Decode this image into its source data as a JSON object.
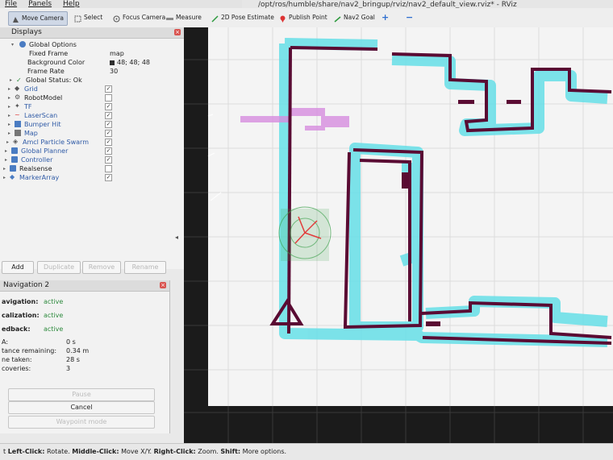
{
  "menu": {
    "items": [
      "File",
      "Panels",
      "Help"
    ]
  },
  "window": {
    "title": "/opt/ros/humble/share/nav2_bringup/rviz/nav2_default_view.rviz* - RViz"
  },
  "toolbar": {
    "move_camera": "Move Camera",
    "select": "Select",
    "focus_camera": "Focus Camera",
    "measure": "Measure",
    "pose_estimate": "2D Pose Estimate",
    "publish_point": "Publish Point",
    "nav2_goal": "Nav2 Goal",
    "plus": "+",
    "minus": "−"
  },
  "displays": {
    "title": "Displays",
    "global_options": "Global Options",
    "fixed_frame_label": "Fixed Frame",
    "fixed_frame_value": "map",
    "bg_color_label": "Background Color",
    "bg_color_value": "48; 48; 48",
    "frame_rate_label": "Frame Rate",
    "frame_rate_value": "30",
    "global_status": "Global Status: Ok",
    "items": [
      {
        "label": "Grid",
        "checked": "✓"
      },
      {
        "label": "RobotModel",
        "checked": ""
      },
      {
        "label": "TF",
        "checked": "✓"
      },
      {
        "label": "LaserScan",
        "checked": "✓"
      },
      {
        "label": "Bumper Hit",
        "checked": "✓"
      },
      {
        "label": "Map",
        "checked": "✓"
      },
      {
        "label": "Amcl Particle Swarm",
        "checked": "✓"
      },
      {
        "label": "Global Planner",
        "checked": "✓"
      },
      {
        "label": "Controller",
        "checked": "✓"
      },
      {
        "label": "Realsense",
        "checked": ""
      },
      {
        "label": "MarkerArray",
        "checked": "✓"
      }
    ],
    "buttons": {
      "add": "Add",
      "duplicate": "Duplicate",
      "remove": "Remove",
      "rename": "Rename"
    }
  },
  "navigation": {
    "title": "Navigation 2",
    "navigation_label": "avigation:",
    "navigation_value": "active",
    "localization_label": "calization:",
    "localization_value": "active",
    "feedback_label": "edback:",
    "feedback_value": "active",
    "eta_label": "A:",
    "eta_value": "0 s",
    "distance_label": "tance remaining:",
    "distance_value": "0.34 m",
    "time_label": "ne taken:",
    "time_value": "28 s",
    "recoveries_label": "coveries:",
    "recoveries_value": "3",
    "pause": "Pause",
    "cancel": "Cancel",
    "waypoint": "Waypoint mode"
  },
  "status": {
    "prefix": "t",
    "left_click": "Left-Click:",
    "left_text": " Rotate. ",
    "middle_click": "Middle-Click:",
    "middle_text": " Move X/Y. ",
    "right_click": "Right-Click:",
    "right_text": " Zoom. ",
    "shift": "Shift:",
    "shift_text": " More options."
  },
  "colors": {
    "wall": "#5a0b33",
    "costmap": "#66e0e8",
    "laser": "#d78de0",
    "particles": "#3aa04a",
    "grid_bg": "#f4f4f4"
  }
}
